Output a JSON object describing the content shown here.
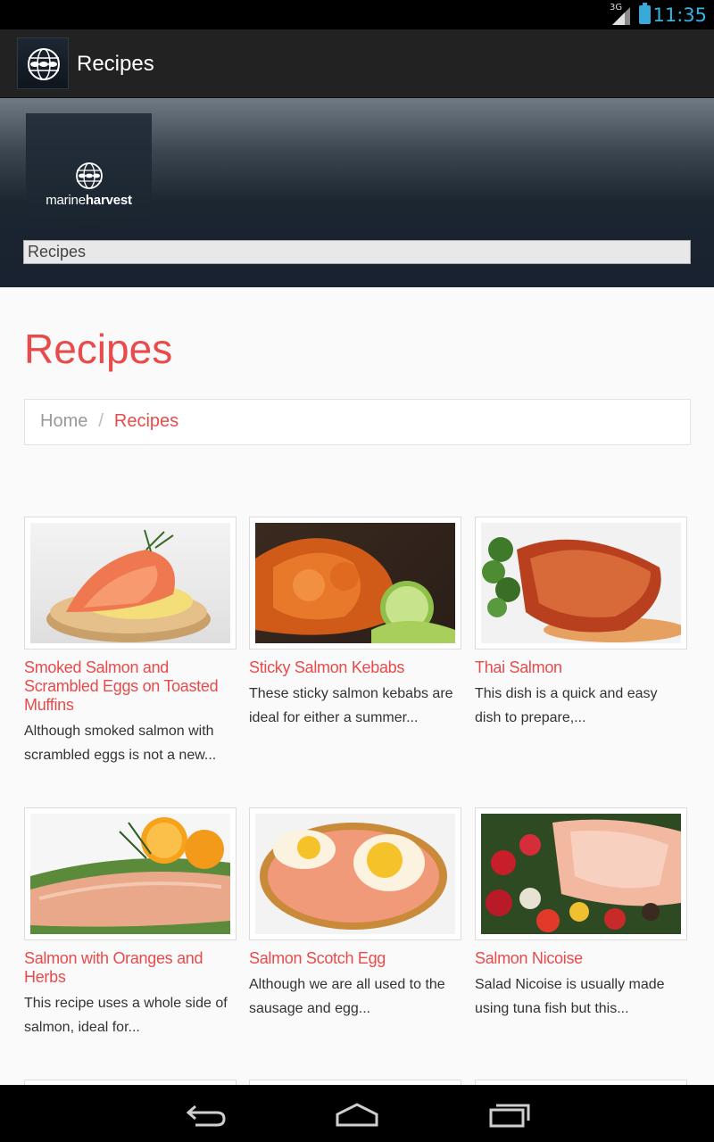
{
  "status_bar": {
    "network": "3G",
    "time": "11:35"
  },
  "action_bar": {
    "title": "Recipes",
    "icon": "marine-harvest-globe-icon"
  },
  "header": {
    "logo": {
      "brand_light": "marine",
      "brand_bold": "harvest"
    },
    "nav_select_value": "Recipes"
  },
  "page": {
    "title": "Recipes",
    "breadcrumb": {
      "home": "Home",
      "separator": "/",
      "current": "Recipes"
    }
  },
  "recipes": [
    {
      "title": "Smoked Salmon and Scrambled Eggs on Toasted Muffins",
      "description": "Although smoked salmon with scrambled eggs is not a new..."
    },
    {
      "title": "Sticky Salmon Kebabs",
      "description": "These sticky salmon kebabs are ideal for either a summer..."
    },
    {
      "title": "Thai Salmon",
      "description": "This dish is a quick and easy dish to prepare,..."
    },
    {
      "title": "Salmon with Oranges and Herbs",
      "description": "This recipe uses a whole side of salmon, ideal for..."
    },
    {
      "title": "Salmon Scotch Egg",
      "description": "Although we are all used to the sausage and egg..."
    },
    {
      "title": "Salmon Nicoise",
      "description": "Salad Nicoise is usually made using tuna fish but this..."
    }
  ],
  "colors": {
    "accent": "#e84b4b",
    "clock": "#33b5e5",
    "action_bar": "#222222"
  }
}
